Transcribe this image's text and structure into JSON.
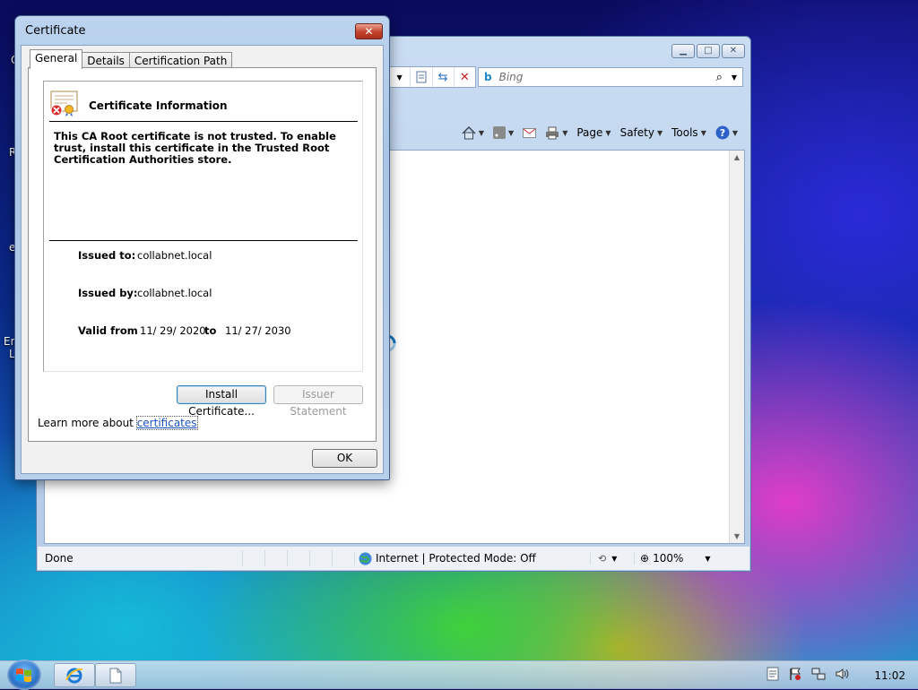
{
  "desktop": {
    "fragments": [
      "C",
      "R",
      "e",
      "En",
      "L"
    ]
  },
  "browser": {
    "search_placeholder": "Bing",
    "command_bar": {
      "page": "Page",
      "safety": "Safety",
      "tools": "Tools"
    },
    "status": {
      "left": "Done",
      "zone": "Internet | Protected Mode: Off",
      "zoom": "100%"
    }
  },
  "dialog": {
    "title": "Certificate",
    "close_label": "✕",
    "tabs": [
      "General",
      "Details",
      "Certification Path"
    ],
    "heading": "Certificate Information",
    "message": "This CA Root certificate is not trusted. To enable trust, install this certificate in the Trusted Root Certification Authorities store.",
    "issued_to_label": "Issued to:",
    "issued_to": "collabnet.local",
    "issued_by_label": "Issued by:",
    "issued_by": "collabnet.local",
    "valid_from_label": "Valid from",
    "valid_from": "11/ 29/ 2020",
    "valid_to_label": "to",
    "valid_to": "11/ 27/ 2030",
    "install_button": "Install Certificate...",
    "issuer_statement_button": "Issuer Statement",
    "learn_more_prefix": "Learn more about",
    "learn_more_link": "certificates",
    "ok_button": "OK"
  },
  "taskbar": {
    "clock": "11:02"
  }
}
